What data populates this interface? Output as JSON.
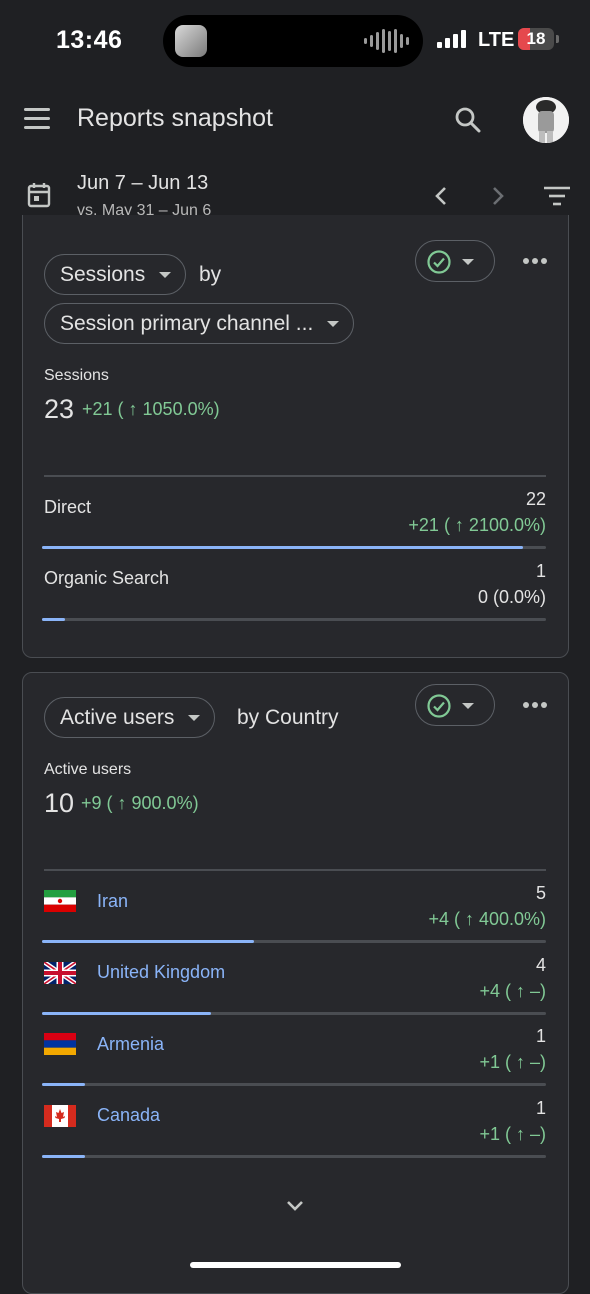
{
  "status_bar": {
    "time": "13:46",
    "network": "LTE",
    "battery": "18"
  },
  "app_bar": {
    "title": "Reports snapshot",
    "menu_icon": "menu-icon",
    "search_icon": "search-icon"
  },
  "date_range": {
    "current": "Jun 7 – Jun 13",
    "comparison": "vs. May 31 – Jun 6"
  },
  "cards": [
    {
      "metric_dropdown": "Sessions",
      "connector": "by",
      "dimension_dropdown": "Session primary channel ...",
      "metric_label": "Sessions",
      "metric_value": "23",
      "metric_change": "+21 ( ↑ 1050.0%)",
      "rows": [
        {
          "name": "Direct",
          "value": "22",
          "change": "+21 ( ↑ 2100.0%)",
          "share": 0.955
        },
        {
          "name": "Organic Search",
          "value": "1",
          "change": "0 (0.0%)",
          "share": 0.045
        }
      ]
    },
    {
      "metric_dropdown": "Active users",
      "connector": "by Country",
      "metric_label": "Active users",
      "metric_value": "10",
      "metric_change": "+9 ( ↑ 900.0%)",
      "rows": [
        {
          "name": "Iran",
          "flag": "iran-flag",
          "value": "5",
          "change": "+4 ( ↑ 400.0%)",
          "share": 0.42
        },
        {
          "name": "United Kingdom",
          "flag": "united-kingdom-flag",
          "value": "4",
          "change": "+4 ( ↑ –)",
          "share": 0.335
        },
        {
          "name": "Armenia",
          "flag": "armenia-flag",
          "value": "1",
          "change": "+1 ( ↑ –)",
          "share": 0.085
        },
        {
          "name": "Canada",
          "flag": "canada-flag",
          "value": "1",
          "change": "+1 ( ↑ –)",
          "share": 0.085
        }
      ]
    }
  ],
  "colors": {
    "background": "#1f2023",
    "card": "#27282c",
    "positive": "#81c995",
    "link": "#8ab4f8",
    "bar": "#8ab4f8"
  }
}
